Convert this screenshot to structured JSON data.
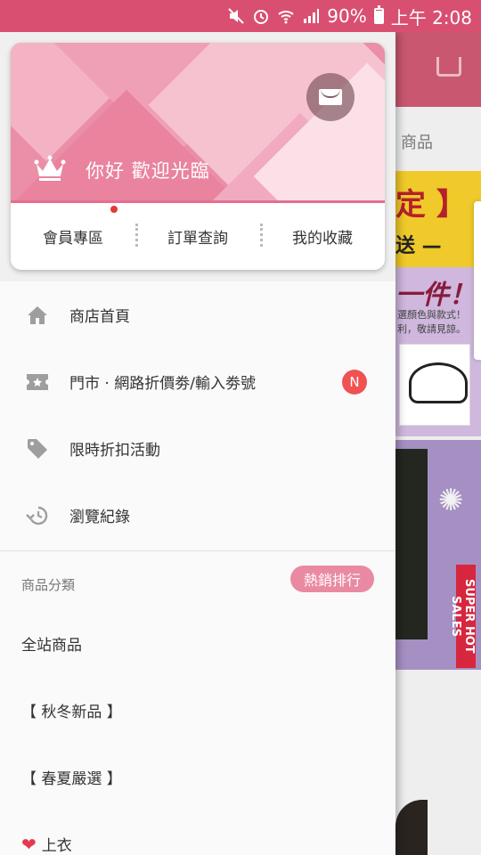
{
  "status_bar": {
    "battery": "90%",
    "time": "上午 2:08"
  },
  "drawer": {
    "greeting": "你好 歡迎光臨",
    "card_links": [
      {
        "label": "會員專區",
        "has_dot": true
      },
      {
        "label": "訂單查詢"
      },
      {
        "label": "我的收藏"
      }
    ],
    "menu": [
      {
        "label": "商店首頁",
        "icon": "home-icon"
      },
      {
        "label": "門市 · 網路折價劵/輸入劵號",
        "icon": "ticket-icon",
        "badge": "N"
      },
      {
        "label": "限時折扣活動",
        "icon": "tag-icon"
      },
      {
        "label": "瀏覽紀錄",
        "icon": "history-icon"
      }
    ],
    "categories_title": "商品分類",
    "hot_button": "熱銷排行",
    "categories": [
      "全站商品",
      "【 秋冬新品 】",
      "【 春夏嚴選 】",
      "上衣"
    ]
  },
  "background": {
    "category_partial": "商品",
    "banner1_a": "定 】",
    "banner1_b": "送 —",
    "banner2_a": "一件！",
    "banner2_b": "選顏色與款式！利，敬請見諒。",
    "vertical": "SUPER HOT SALES"
  },
  "colors": {
    "accent": "#d94f72",
    "pink": "#ea8aa2",
    "badge_red": "#f05252"
  }
}
